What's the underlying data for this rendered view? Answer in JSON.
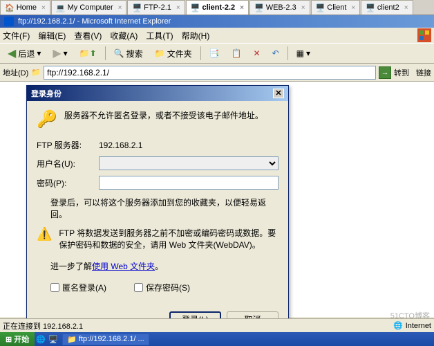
{
  "tabs": [
    {
      "label": "Home",
      "icon": "🏠"
    },
    {
      "label": "My Computer",
      "icon": "💻"
    },
    {
      "label": "FTP-2.1",
      "icon": "📄"
    },
    {
      "label": "client-2.2",
      "icon": "📄",
      "active": true
    },
    {
      "label": "WEB-2.3",
      "icon": "📄"
    },
    {
      "label": "Client",
      "icon": "📄"
    },
    {
      "label": "client2",
      "icon": "📄"
    }
  ],
  "window": {
    "title": "ftp://192.168.2.1/ - Microsoft Internet Explorer"
  },
  "menu": {
    "file": "文件(F)",
    "edit": "编辑(E)",
    "view": "查看(V)",
    "fav": "收藏(A)",
    "tools": "工具(T)",
    "help": "帮助(H)"
  },
  "toolbar": {
    "back": "后退",
    "search": "搜索",
    "folders": "文件夹"
  },
  "address": {
    "label": "地址(D)",
    "value": "ftp://192.168.2.1/",
    "go": "转到",
    "links": "链接"
  },
  "dialog": {
    "title": "登录身份",
    "message": "服务器不允许匿名登录，或者不接受该电子邮件地址。",
    "server_label": "FTP 服务器:",
    "server_value": "192.168.2.1",
    "user_label": "用户名(U):",
    "password_label": "密码(P):",
    "note1": "登录后，可以将这个服务器添加到您的收藏夹，以便轻易返回。",
    "note2": "FTP 将数据发送到服务器之前不加密或编码密码或数据。要保护密码和数据的安全，请用 Web 文件夹(WebDAV)。",
    "learn_prefix": "进一步了解",
    "learn_link": "使用 Web 文件夹",
    "anon": "匿名登录(A)",
    "save_pw": "保存密码(S)",
    "login": "登录(L)",
    "cancel": "取消"
  },
  "status": {
    "connecting": "正在连接到 192.168.2.1",
    "zone": "Internet"
  },
  "taskbar": {
    "start": "开始",
    "task1": "ftp://192.168.2.1/ ..."
  },
  "watermark": "51CTO博客"
}
